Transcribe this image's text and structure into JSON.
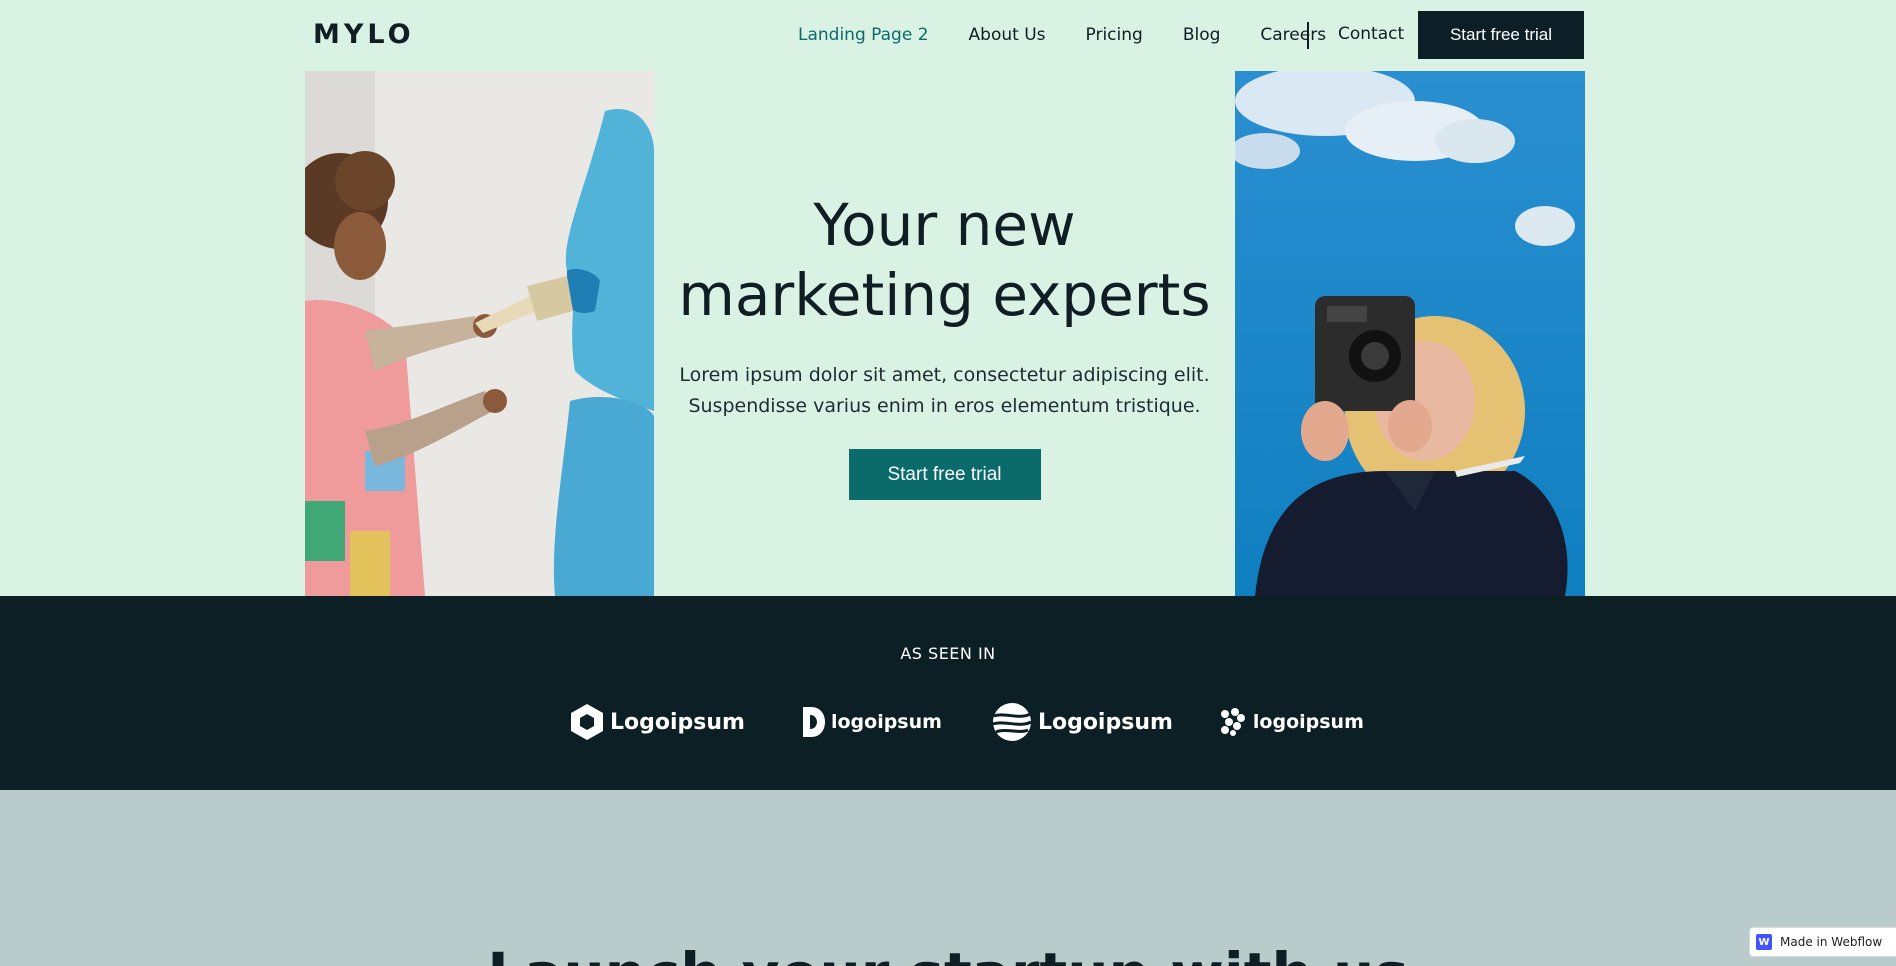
{
  "nav": {
    "logo": "MYLO",
    "links": [
      {
        "label": "Landing Page 2"
      },
      {
        "label": "About Us"
      },
      {
        "label": "Pricing"
      },
      {
        "label": "Blog"
      },
      {
        "label": "Careers"
      }
    ],
    "contact": "Contact",
    "cta": "Start free trial"
  },
  "hero": {
    "title_line1": "Your new",
    "title_line2": "marketing experts",
    "subtitle_line1": "Lorem ipsum dolor sit amet, consectetur adipiscing elit.",
    "subtitle_line2": "Suspendisse varius enim in eros elementum tristique.",
    "cta": "Start free trial"
  },
  "seen_in": {
    "label": "AS SEEN IN",
    "logos": [
      {
        "text": "Logoipsum",
        "icon": "hexagon-logo-icon"
      },
      {
        "text": "logoipsum",
        "icon": "d-shape-logo-icon"
      },
      {
        "text": "Logoipsum",
        "icon": "wave-circle-logo-icon"
      },
      {
        "text": "logoipsum",
        "icon": "dots-pattern-logo-icon"
      }
    ]
  },
  "next_section": {
    "title": "Launch your startup with us"
  },
  "badge": {
    "label": "Made in Webflow"
  },
  "colors": {
    "background": "#daf2e3",
    "dark": "#0c1f25",
    "accent": "#0b6b6b",
    "active_link": "#0b6b6b",
    "next_section": "#b9cbca"
  }
}
